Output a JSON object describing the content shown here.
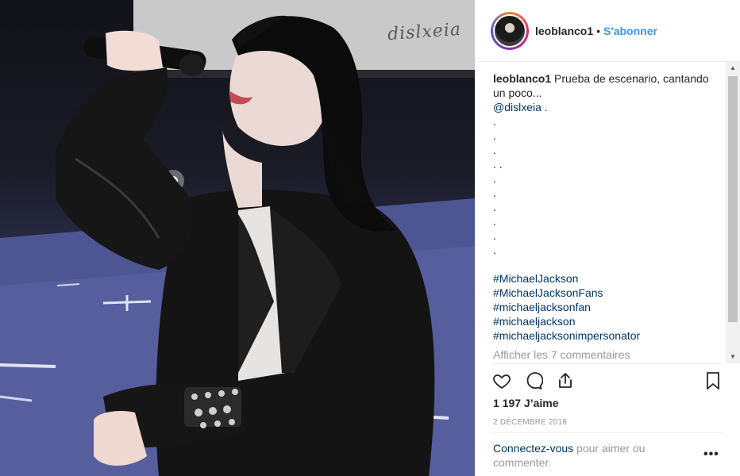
{
  "header": {
    "username": "leoblanco1",
    "separator": "•",
    "follow_label": "S'abonner"
  },
  "photo": {
    "watermark": "dislxeia",
    "alt": "Performer in black leather jacket singing into a microphone on stage"
  },
  "caption": {
    "username": "leoblanco1",
    "text": "Prueba de escenario, cantando un poco...",
    "mention": "@dislxeia .",
    "dot_lines": [
      ".",
      ".",
      ".",
      ". .",
      ".",
      ".",
      ".",
      ".",
      ".",
      "."
    ],
    "hashtags": [
      "#MichaelJackson",
      "#MichaelJacksonFans",
      "#michaeljacksonfan",
      "#michaeljackson",
      "#michaeljacksonimpersonator"
    ],
    "view_comments": "Afficher les 7 commentaires"
  },
  "actions": {
    "like_icon": "heart-icon",
    "comment_icon": "comment-icon",
    "share_icon": "share-icon",
    "save_icon": "bookmark-icon"
  },
  "likes": "1 197 J’aime",
  "date": "2 décembre 2018",
  "login": {
    "link": "Connectez-vous",
    "text": " pour aimer ou commenter."
  },
  "more_label": "•••",
  "colors": {
    "link_blue": "#3897f0",
    "hashtag_blue": "#003569",
    "muted": "#999999"
  }
}
